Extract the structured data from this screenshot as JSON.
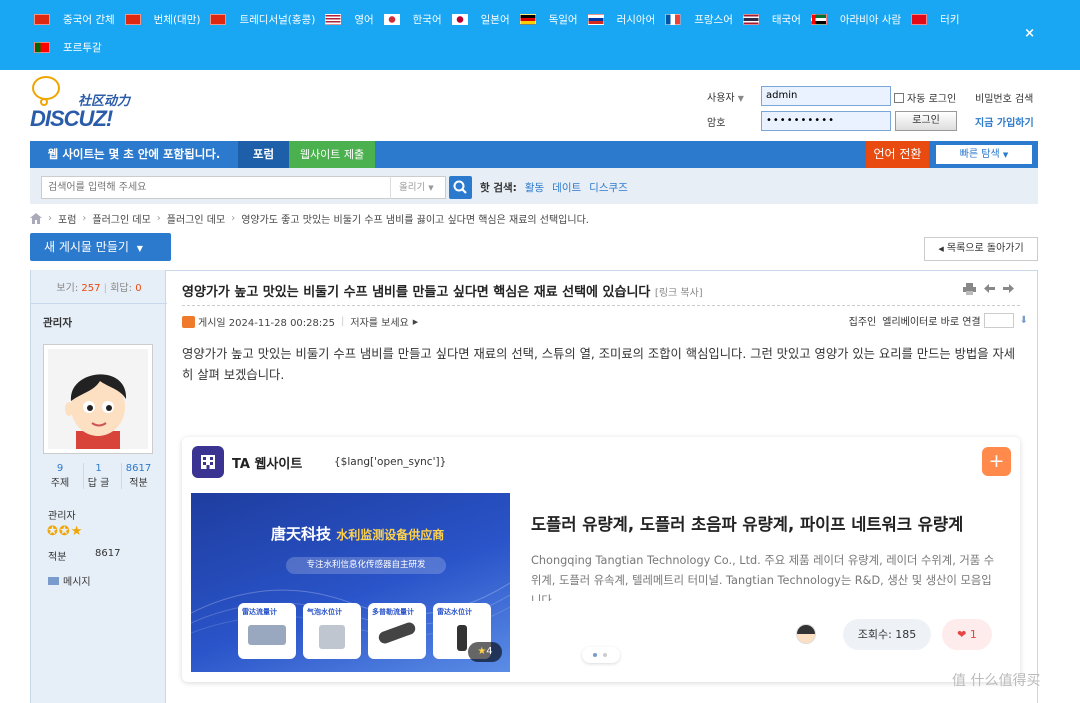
{
  "lang_bar": {
    "languages": [
      {
        "label": "중국어 간체",
        "flag": "cn"
      },
      {
        "label": "번체(대만)",
        "flag": "cn"
      },
      {
        "label": "트레디서널(홍콩)",
        "flag": "cn"
      },
      {
        "label": "영어",
        "flag": "us"
      },
      {
        "label": "한국어",
        "flag": "kr"
      },
      {
        "label": "일본어",
        "flag": "jp"
      },
      {
        "label": "독일어",
        "flag": "de"
      },
      {
        "label": "러시아어",
        "flag": "ru"
      },
      {
        "label": "프랑스어",
        "flag": "fr"
      },
      {
        "label": "태국어",
        "flag": "th"
      },
      {
        "label": "아라비아 사람",
        "flag": "ae"
      },
      {
        "label": "터키",
        "flag": "tr"
      },
      {
        "label": "포르투갈",
        "flag": "pt"
      }
    ],
    "close_icon": "×",
    "bg_color": "#19a6f2"
  },
  "logo": {
    "cn_text": "社区动力",
    "word": "DISCUZ!"
  },
  "login": {
    "username_label": "사용자",
    "username_value": "admin",
    "password_label": "암호",
    "password_value": "••••••••••",
    "auto_login": "자동 로그인",
    "login_button": "로그인",
    "forgot": "비밀번호 검색",
    "register": "지금 가입하기"
  },
  "nav": {
    "slogan": "웹 사이트는 몇 초 안에 포함됩니다.",
    "items": [
      "포럼",
      "웹사이트 제출"
    ],
    "lang_switch": "언어 전환",
    "quick_nav": "빠른 탐색",
    "primary_color": "#2b7acd"
  },
  "search": {
    "placeholder": "검색어를 입력해 주세요",
    "type": "올리기",
    "hot_label": "핫 검색:",
    "hot_terms": [
      "활동",
      "데이트",
      "디스쿠즈"
    ]
  },
  "breadcrumb": [
    "포럼",
    "플러그인 데모",
    "플러그인 데모",
    "영양가도 좋고 맛있는 비둘기 수프 냄비를 끓이고 싶다면 핵심은 재료의 선택입니다."
  ],
  "buttons": {
    "new_post": "새 게시물 만들기",
    "back_list": "목록으로 돌아가기"
  },
  "sidebar": {
    "views_label": "보기:",
    "views": "257",
    "replies_label": "회답:",
    "replies": "0",
    "author": "관리자",
    "stats": [
      {
        "value": "9",
        "label": "주제"
      },
      {
        "value": "1",
        "label": "답 글"
      },
      {
        "value": "8617",
        "label": "적분"
      }
    ],
    "group": "관리자",
    "score_label": "적분",
    "score": "8617",
    "message": "메시지"
  },
  "post": {
    "title": "영양가가 높고 맛있는 비둘기 수프 냄비를 만들고 싶다면 핵심은 재료 선택에 있습니다",
    "copy_link": "[링크 복사]",
    "posted": "게시일 2024-11-28 00:28:25",
    "author_only": "저자를 보세요",
    "floor_label": "집주인",
    "jump_label": "엘리베이터로 바로 연결",
    "body": "영양가가 높고 맛있는 비둘기 수프 냄비를 만들고 싶다면 재료의 선택, 스튜의 열, 조미료의 조합이 핵심입니다. 그런 맛있고 영양가 있는 요리를 만드는 방법을 자세히 살펴 보겠습니다."
  },
  "card": {
    "site_name": "TA 웹사이트",
    "sync_text": "{$lang['open_sync']}",
    "plus": "+",
    "banner_title": "唐天科技",
    "banner_subtitle": "水利监测设备供应商",
    "banner_tagline": "专注水利信息化传感器自主研发",
    "banner_products": [
      "雷达流量计",
      "气泡水位计",
      "多普勒流量计",
      "雷达水位计"
    ],
    "rating": "4",
    "headline": "도플러 유량계, 도플러 초음파 유량계, 파이프 네트워크 유량계",
    "description": "Chongqing Tangtian Technology Co., Ltd. 주요 제품 레이더 유량계, 레이더 수위계, 거품 수위계, 도플러 유속계, 텔레메트리 터미널. Tangtian Technology는 R&D, 생산 및 생산이 모음입니다",
    "views": "조회수: 185",
    "likes": "1"
  },
  "watermark": "值 什么值得买"
}
